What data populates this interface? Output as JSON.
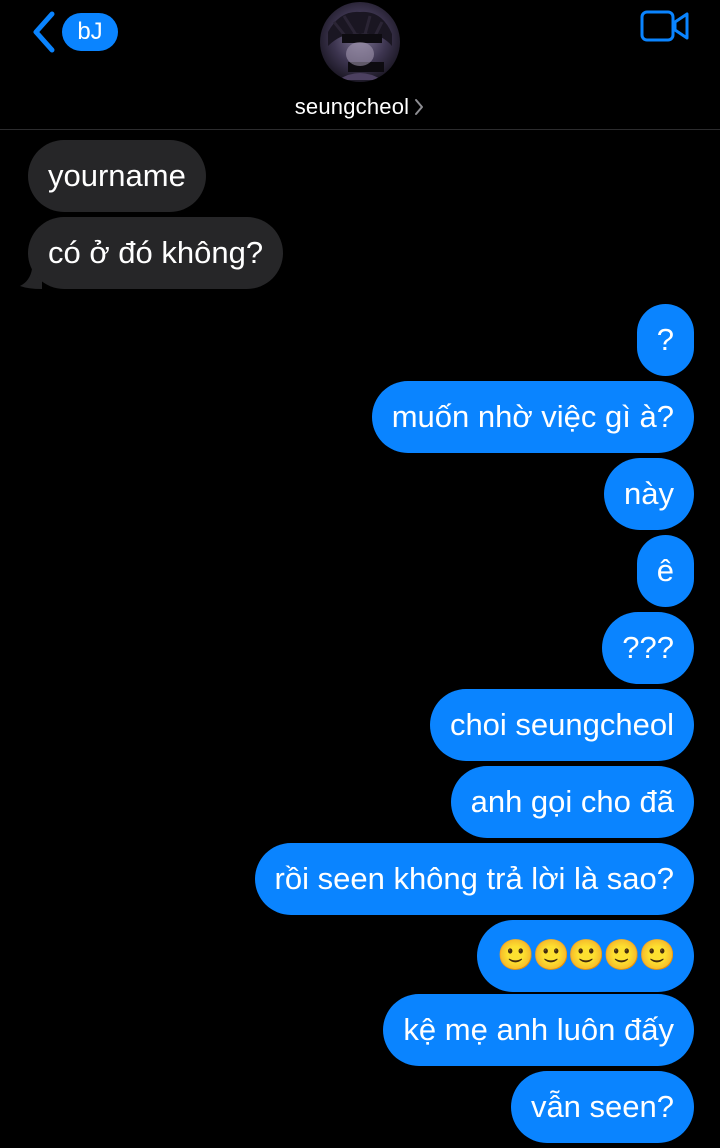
{
  "header": {
    "back_badge": "bJ",
    "contact_name": "seungcheol",
    "icons": {
      "back": "chevron-left-icon",
      "video": "video-camera-icon",
      "name_chevron": "chevron-right-icon"
    },
    "accent_color": "#0a84ff"
  },
  "messages": [
    {
      "direction": "incoming",
      "text": "yourname"
    },
    {
      "direction": "incoming",
      "text": "có ở đó không?"
    },
    {
      "direction": "outgoing",
      "text": "?"
    },
    {
      "direction": "outgoing",
      "text": "muốn nhờ việc gì à?"
    },
    {
      "direction": "outgoing",
      "text": "này"
    },
    {
      "direction": "outgoing",
      "text": "ê"
    },
    {
      "direction": "outgoing",
      "text": "???"
    },
    {
      "direction": "outgoing",
      "text": "choi seungcheol"
    },
    {
      "direction": "outgoing",
      "text": "anh gọi cho đã"
    },
    {
      "direction": "outgoing",
      "text": "rồi seen không trả lời là sao?"
    },
    {
      "direction": "outgoing",
      "text": "🙂🙂🙂🙂🙂"
    },
    {
      "direction": "outgoing",
      "text": "kệ mẹ anh luôn đấy"
    },
    {
      "direction": "outgoing",
      "text": "vẫn seen?"
    }
  ],
  "colors": {
    "incoming_bubble": "#262628",
    "outgoing_bubble": "#0a84ff",
    "background": "#000000"
  }
}
